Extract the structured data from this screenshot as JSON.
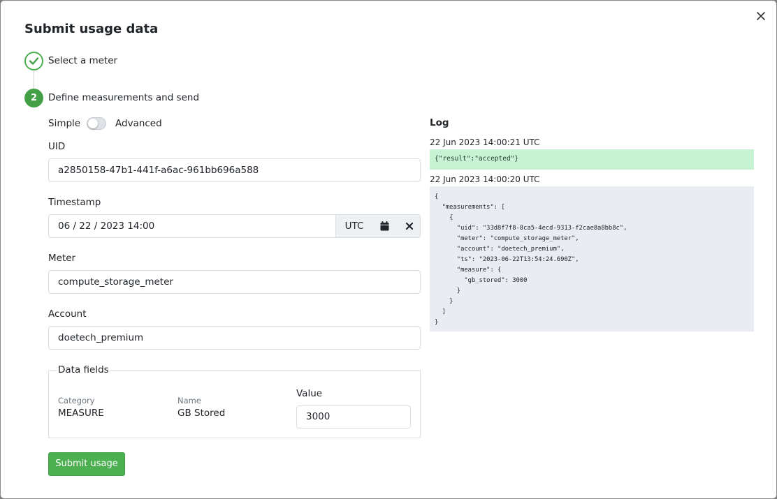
{
  "dialog": {
    "title": "Submit usage data",
    "close_icon": "close-icon"
  },
  "steps": [
    {
      "number": "1",
      "label": "Select a meter",
      "status": "complete"
    },
    {
      "number": "2",
      "label": "Define measurements and send",
      "status": "active"
    }
  ],
  "mode": {
    "simple_label": "Simple",
    "advanced_label": "Advanced",
    "advanced_enabled": false
  },
  "form": {
    "uid": {
      "label": "UID",
      "value": "a2850158-47b1-441f-a6ac-961bb696a588"
    },
    "timestamp": {
      "label": "Timestamp",
      "value": "06 / 22 / 2023 14:00",
      "timezone": "UTC"
    },
    "meter": {
      "label": "Meter",
      "value": "compute_storage_meter"
    },
    "account": {
      "label": "Account",
      "value": "doetech_premium"
    },
    "data_fields": {
      "legend": "Data fields",
      "category_label": "Category",
      "category_value": "MEASURE",
      "name_label": "Name",
      "name_value": "GB Stored",
      "value_label": "Value",
      "value": "3000"
    },
    "submit_label": "Submit usage"
  },
  "log": {
    "title": "Log",
    "entries": [
      {
        "time": "22 Jun 2023 14:00:21 UTC",
        "body": "{\"result\":\"accepted\"}",
        "status": "success"
      },
      {
        "time": "22 Jun 2023 14:00:20 UTC",
        "body": "{\n  \"measurements\": [\n    {\n      \"uid\": \"33d8f7f8-8ca5-4ecd-9313-f2cae8a8bb8c\",\n      \"meter\": \"compute_storage_meter\",\n      \"account\": \"doetech_premium\",\n      \"ts\": \"2023-06-22T13:54:24.690Z\",\n      \"measure\": {\n        \"gb_stored\": 3000\n      }\n    }\n  ]\n}",
        "status": "request"
      }
    ]
  },
  "colors": {
    "primary": "#4caf50",
    "success_bg": "#c8f2d4",
    "log_bg": "#e9ecf1"
  }
}
